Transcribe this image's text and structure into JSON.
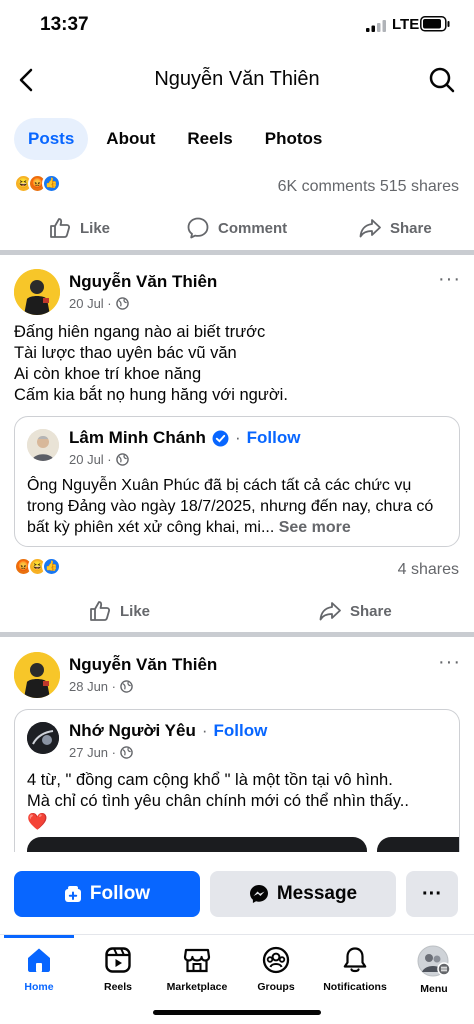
{
  "status": {
    "time": "13:37",
    "network": "LTE"
  },
  "header": {
    "title": "Nguyễn Văn Thiên"
  },
  "tabs": [
    {
      "label": "Posts",
      "active": true
    },
    {
      "label": "About",
      "active": false
    },
    {
      "label": "Reels",
      "active": false
    },
    {
      "label": "Photos",
      "active": false
    }
  ],
  "prev_post": {
    "reactions": [
      "haha",
      "angry",
      "like"
    ],
    "stats": "6K comments  515 shares",
    "actions": {
      "like": "Like",
      "comment": "Comment",
      "share": "Share"
    }
  },
  "post1": {
    "author": "Nguyễn Văn Thiên",
    "date": "20 Jul ·",
    "text_lines": [
      "Đấng hiên ngang nào ai biết trước",
      "Tài lược thao uyên bác vũ văn",
      "Ai còn khoe trí khoe năng",
      "Cấm kia bắt nọ hung hăng với người."
    ],
    "shared": {
      "author": "Lâm Minh Chánh",
      "follow": "Follow",
      "dot": "·",
      "date": "20 Jul ·",
      "text": "Ông Nguyễn Xuân Phúc đã bị cách tất cả các chức vụ trong Đảng vào ngày 18/7/2025, nhưng đến nay, chưa có bất kỳ phiên xét xử công khai, mi...",
      "see_more": "See more"
    },
    "reactions": [
      "angry",
      "haha",
      "like"
    ],
    "stats": "4 shares",
    "actions": {
      "like": "Like",
      "share": "Share"
    }
  },
  "post2": {
    "author": "Nguyễn Văn Thiên",
    "date": "28 Jun ·",
    "shared": {
      "author": "Nhớ Người Yêu",
      "dot": "·",
      "follow": "Follow",
      "date": "27 Jun ·",
      "text_lines": [
        "4 từ, \" đồng cam cộng khổ \" là một tồn tại vô hình.",
        "Mà chỉ có tình yêu chân chính mới có thể nhìn thấy.."
      ],
      "heart": "❤️"
    }
  },
  "cta": {
    "follow": "Follow",
    "message": "Message",
    "more": "···"
  },
  "nav": [
    {
      "label": "Home",
      "icon": "home-icon"
    },
    {
      "label": "Reels",
      "icon": "reels-icon"
    },
    {
      "label": "Marketplace",
      "icon": "marketplace-icon"
    },
    {
      "label": "Groups",
      "icon": "groups-icon"
    },
    {
      "label": "Notifications",
      "icon": "bell-icon"
    },
    {
      "label": "Menu",
      "icon": "profile-menu-icon"
    }
  ],
  "colors": {
    "accent": "#0866ff",
    "muted": "#65676b",
    "divider": "#c9ccd1"
  }
}
